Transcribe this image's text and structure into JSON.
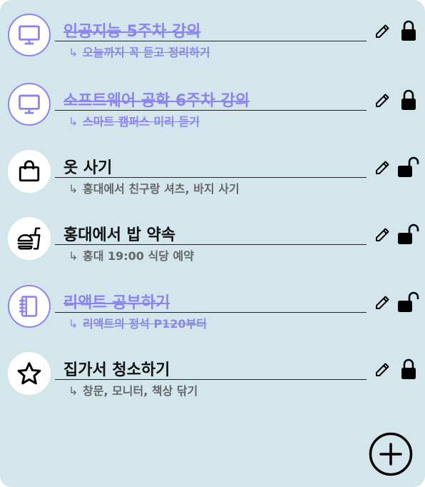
{
  "colors": {
    "panel": "#d3e6ec",
    "done": "#8c85f0",
    "text": "#111111",
    "subtext": "#666666"
  },
  "todos": [
    {
      "title": "인공지능 5주차 강의",
      "subtitle": "오늘까지 꼭 듣고 정리하기",
      "icon": "monitor-icon",
      "done": true,
      "locked": true
    },
    {
      "title": "소프트웨어 공학 6주차 강의",
      "subtitle": "스마트 캠퍼스 미리 듣기",
      "icon": "monitor-icon",
      "done": true,
      "locked": true
    },
    {
      "title": "옷 사기",
      "subtitle": "홍대에서 친구랑 셔츠, 바지 사기",
      "icon": "shopping-bag-icon",
      "done": false,
      "locked": false
    },
    {
      "title": "홍대에서 밥 약속",
      "subtitle": "홍대 19:00 식당 예약",
      "icon": "fast-food-icon",
      "done": false,
      "locked": false
    },
    {
      "title": "리액트 공부하기",
      "subtitle": "리액트의 정석 P120부터",
      "icon": "notebook-icon",
      "done": true,
      "locked": false
    },
    {
      "title": "집가서 청소하기",
      "subtitle": "창문, 모니터, 책상 닦기",
      "icon": "star-icon",
      "done": false,
      "locked": true
    }
  ],
  "subtitle_arrow": "↳",
  "add_button": {
    "icon": "plus-circle-icon"
  }
}
